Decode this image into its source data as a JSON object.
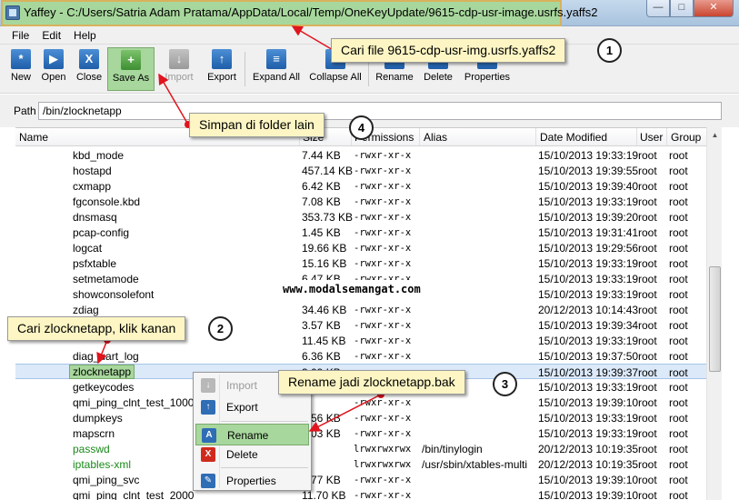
{
  "window": {
    "title": "Yaffey - C:/Users/Satria Adam Pratama/AppData/Local/Temp/OneKeyUpdate/9615-cdp-usr-image.usrfs.yaffs2"
  },
  "menu": [
    "File",
    "Edit",
    "Help"
  ],
  "toolbar": {
    "new": "New",
    "open": "Open",
    "close": "Close",
    "save_as": "Save As",
    "import": "Import",
    "export": "Export",
    "expand_all": "Expand All",
    "collapse_all": "Collapse All",
    "rename": "Rename",
    "delete": "Delete",
    "properties": "Properties"
  },
  "path": {
    "label": "Path",
    "value": "/bin/zlocknetapp"
  },
  "columns": [
    "Name",
    "Size",
    "Permissions",
    "Alias",
    "Date Modified",
    "User",
    "Group"
  ],
  "rows": [
    {
      "name": "kbd_mode",
      "size": "7.44 KB",
      "perm": "-rwxr-xr-x",
      "alias": "",
      "date": "15/10/2013 19:33:19",
      "user": "root",
      "group": "root"
    },
    {
      "name": "hostapd",
      "size": "457.14 KB",
      "perm": "-rwxr-xr-x",
      "alias": "",
      "date": "15/10/2013 19:39:55",
      "user": "root",
      "group": "root"
    },
    {
      "name": "cxmapp",
      "size": "6.42 KB",
      "perm": "-rwxr-xr-x",
      "alias": "",
      "date": "15/10/2013 19:39:40",
      "user": "root",
      "group": "root"
    },
    {
      "name": "fgconsole.kbd",
      "size": "7.08 KB",
      "perm": "-rwxr-xr-x",
      "alias": "",
      "date": "15/10/2013 19:33:19",
      "user": "root",
      "group": "root"
    },
    {
      "name": "dnsmasq",
      "size": "353.73 KB",
      "perm": "-rwxr-xr-x",
      "alias": "",
      "date": "15/10/2013 19:39:20",
      "user": "root",
      "group": "root"
    },
    {
      "name": "pcap-config",
      "size": "1.45 KB",
      "perm": "-rwxr-xr-x",
      "alias": "",
      "date": "15/10/2013 19:31:41",
      "user": "root",
      "group": "root"
    },
    {
      "name": "logcat",
      "size": "19.66 KB",
      "perm": "-rwxr-xr-x",
      "alias": "",
      "date": "15/10/2013 19:29:56",
      "user": "root",
      "group": "root"
    },
    {
      "name": "psfxtable",
      "size": "15.16 KB",
      "perm": "-rwxr-xr-x",
      "alias": "",
      "date": "15/10/2013 19:33:19",
      "user": "root",
      "group": "root"
    },
    {
      "name": "setmetamode",
      "size": "6.47 KB",
      "perm": "-rwxr-xr-x",
      "alias": "",
      "date": "15/10/2013 19:33:19",
      "user": "root",
      "group": "root"
    },
    {
      "name": "showconsolefont",
      "size": "13.35 KB",
      "perm": "-rwxr-xr-x",
      "alias": "",
      "date": "15/10/2013 19:33:19",
      "user": "root",
      "group": "root"
    },
    {
      "name": "zdiag",
      "size": "34.46 KB",
      "perm": "-rwxr-xr-x",
      "alias": "",
      "date": "20/12/2013 10:14:43",
      "user": "root",
      "group": "root"
    },
    {
      "name": "",
      "size": "3.57 KB",
      "perm": "-rwxr-xr-x",
      "alias": "",
      "date": "15/10/2013 19:39:34",
      "user": "root",
      "group": "root"
    },
    {
      "name": "",
      "size": "11.45 KB",
      "perm": "-rwxr-xr-x",
      "alias": "",
      "date": "15/10/2013 19:33:19",
      "user": "root",
      "group": "root"
    },
    {
      "name": "diag_uart_log",
      "size": "6.36 KB",
      "perm": "-rwxr-xr-x",
      "alias": "",
      "date": "15/10/2013 19:37:50",
      "user": "root",
      "group": "root"
    },
    {
      "name": "zlocknetapp",
      "size": "3.09 KB",
      "perm": "-rwxr-xr-x",
      "alias": "",
      "date": "15/10/2013 19:39:37",
      "user": "root",
      "group": "root"
    },
    {
      "name": "getkeycodes",
      "size": "",
      "perm": "-rwxr-xr-x",
      "alias": "",
      "date": "15/10/2013 19:33:19",
      "user": "root",
      "group": "root"
    },
    {
      "name": "qmi_ping_clnt_test_1000",
      "size": "",
      "perm": "-rwxr-xr-x",
      "alias": "",
      "date": "15/10/2013 19:39:10",
      "user": "root",
      "group": "root"
    },
    {
      "name": "dumpkeys",
      "size": "4.56 KB",
      "perm": "-rwxr-xr-x",
      "alias": "",
      "date": "15/10/2013 19:33:19",
      "user": "root",
      "group": "root"
    },
    {
      "name": "mapscrn",
      "size": "4.03 KB",
      "perm": "-rwxr-xr-x",
      "alias": "",
      "date": "15/10/2013 19:33:19",
      "user": "root",
      "group": "root"
    },
    {
      "name": "passwd",
      "size": "",
      "perm": "lrwxrwxrwx",
      "alias": "/bin/tinylogin",
      "date": "20/12/2013 10:19:35",
      "user": "root",
      "group": "root",
      "link": true
    },
    {
      "name": "iptables-xml",
      "size": "",
      "perm": "lrwxrwxrwx",
      "alias": "/usr/sbin/xtables-multi",
      "date": "20/12/2013 10:19:35",
      "user": "root",
      "group": "root",
      "link": true
    },
    {
      "name": "qmi_ping_svc",
      "size": "4.77 KB",
      "perm": "-rwxr-xr-x",
      "alias": "",
      "date": "15/10/2013 19:39:10",
      "user": "root",
      "group": "root"
    },
    {
      "name": "qmi_ping_clnt_test_2000",
      "size": "11.70 KB",
      "perm": "-rwxr-xr-x",
      "alias": "",
      "date": "15/10/2013 19:39:10",
      "user": "root",
      "group": "root"
    }
  ],
  "context_menu": {
    "import": "Import",
    "export": "Export",
    "rename": "Rename",
    "delete": "Delete",
    "properties": "Properties"
  },
  "callouts": {
    "c1": "Cari file 9615-cdp-usr-img.usrfs.yaffs2",
    "c2": "Cari zlocknetapp, klik kanan",
    "c3": "Rename jadi zlocknetapp.bak",
    "c4": "Simpan di folder lain",
    "n1": "1",
    "n2": "2",
    "n3": "3",
    "n4": "4"
  },
  "watermark": "www.modalsemangat.com",
  "colors": {
    "highlight": "#a7d79c",
    "callout_bg": "#fdf6c4",
    "arrow": "#e0141e",
    "link_text": "#1a8a1a"
  }
}
